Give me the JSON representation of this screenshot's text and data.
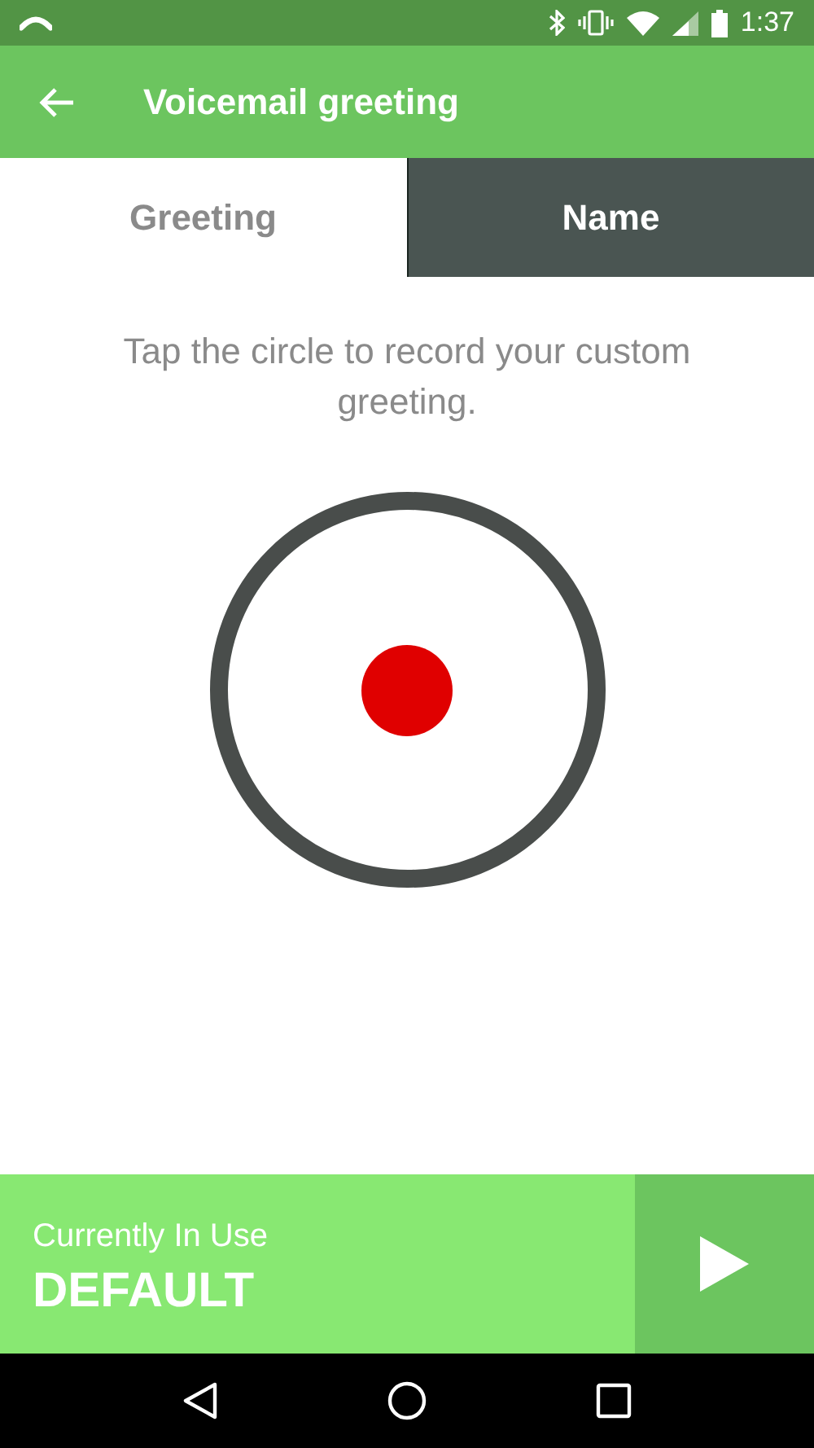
{
  "status_bar": {
    "time": "1:37"
  },
  "app_bar": {
    "title": "Voicemail greeting"
  },
  "tabs": [
    {
      "label": "Greeting",
      "selected": true
    },
    {
      "label": "Name",
      "selected": false
    }
  ],
  "instruction": "Tap the circle to record your custom greeting.",
  "current": {
    "label": "Currently In Use",
    "value": "DEFAULT"
  }
}
